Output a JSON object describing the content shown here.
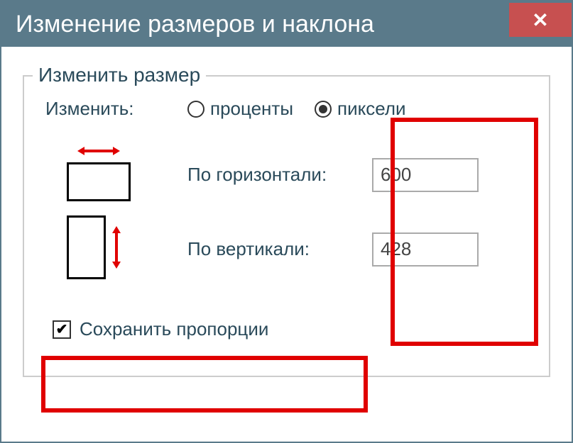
{
  "dialog": {
    "title": "Изменение размеров и наклона"
  },
  "resize": {
    "legend": "Изменить размер",
    "change_label": "Изменить:",
    "unit_percent": "проценты",
    "unit_pixels": "пиксели",
    "horizontal_label": "По горизонтали:",
    "vertical_label": "По вертикали:",
    "horizontal_value": "600",
    "vertical_value": "428",
    "keep_aspect_label": "Сохранить пропорции"
  }
}
